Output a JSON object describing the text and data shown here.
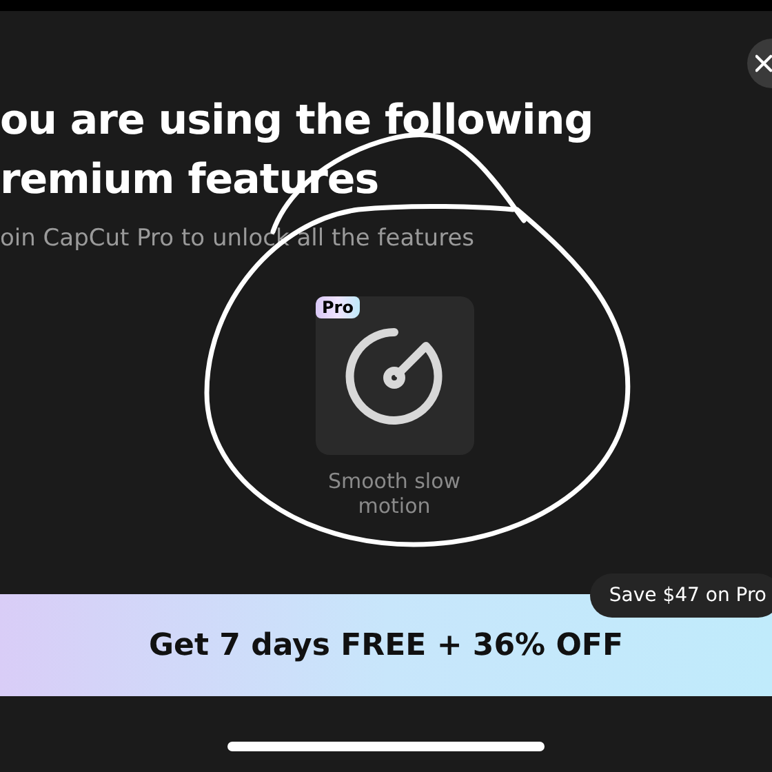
{
  "heading_lines": [
    "ou are using the following",
    "remium features"
  ],
  "subtitle": "oin CapCut Pro to unlock all the features",
  "features": [
    {
      "name": "Smooth slow motion",
      "badge": "Pro"
    }
  ],
  "savings_tip": "Save $47 on Pro",
  "offer_button": {
    "label": "Get 7 days FREE + 36% OFF"
  }
}
